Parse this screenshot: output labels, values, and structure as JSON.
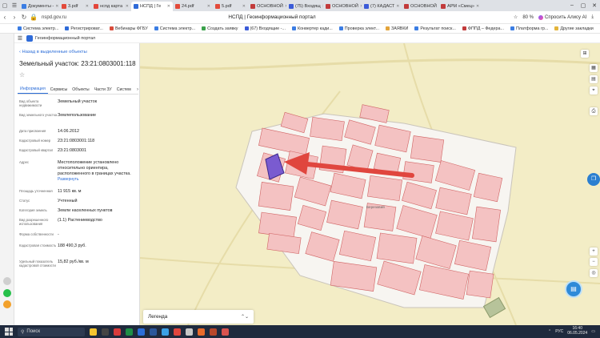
{
  "browser": {
    "tabs": [
      {
        "label": "Документы -",
        "color": "#3b7de3"
      },
      {
        "label": "3.pdf",
        "color": "#e34b3b"
      },
      {
        "label": "нспд картa",
        "color": "#e3463b"
      },
      {
        "label": "НСПД | Ге",
        "color": "#2f6bd8",
        "active": true
      },
      {
        "label": "24.pdf",
        "color": "#e34b3b"
      },
      {
        "label": "5.pdf",
        "color": "#e34b3b"
      },
      {
        "label": "ОСНОВНОЙ",
        "color": "#c23b3b"
      },
      {
        "label": "(75) Входящ",
        "color": "#3b5bd8"
      },
      {
        "label": "ОСНОВНОЙ",
        "color": "#c23b3b"
      },
      {
        "label": "(7) КАДАСТ",
        "color": "#3b5bd8"
      },
      {
        "label": "ОСНОВНОЙ",
        "color": "#c23b3b"
      },
      {
        "label": "АРМ «Смец»",
        "color": "#c23b3b"
      }
    ],
    "url": "nspd.gov.ru",
    "page_title": "НСПД | Геоинформационный портал",
    "battery": "80 %",
    "alisa_label": "Спросить Алису AI",
    "bookmarks": [
      {
        "label": "Система электр...",
        "color": "#3b7de3"
      },
      {
        "label": "Регистрироват...",
        "color": "#2f6bd8"
      },
      {
        "label": "Вебинары ФГБУ",
        "color": "#d84c3b"
      },
      {
        "label": "Система электр...",
        "color": "#3b7de3"
      },
      {
        "label": "Создать заявку",
        "color": "#3ba14b"
      },
      {
        "label": "(67) Входящие -...",
        "color": "#3b5bd8"
      },
      {
        "label": "Конвертер кади...",
        "color": "#3b7de3"
      },
      {
        "label": "Проверка элект...",
        "color": "#3b7de3"
      },
      {
        "label": "ЗАЯВКИ",
        "color": "#e3a43b"
      },
      {
        "label": "Результат поиск...",
        "color": "#3b7de3"
      },
      {
        "label": "ФППД – Федера...",
        "color": "#c23b3b"
      },
      {
        "label": "Платформа гр...",
        "color": "#3b7de3"
      }
    ],
    "other_bookmarks": "Другие закладки"
  },
  "app": {
    "portal_name": "Геоинформационный портал"
  },
  "panel": {
    "back_label": "Назад в выделенные объекты",
    "title": "Земельный участок: 23:21:0803001:118",
    "tabs": [
      "Информация",
      "Сервисы",
      "Объекты",
      "Части ЗУ",
      "Систем"
    ],
    "rows": [
      {
        "label": "Вид объекта недвижимости",
        "value": "Земельный участок"
      },
      {
        "label": "Вид земельного участка",
        "value": "Землепользование"
      },
      {
        "label": "Дата присвоения",
        "value": "14.06.2012"
      },
      {
        "label": "Кадастровый номер",
        "value": "23:21:0803001:118"
      },
      {
        "label": "Кадастровый квартал",
        "value": "23:21:0803001"
      },
      {
        "label": "Адрес",
        "value": "Местоположение установлено относительно ориентира, расположенного в границах участка.",
        "more": "Развернуть"
      },
      {
        "label": "Площадь уточненная",
        "value": "11 915 кв. м"
      },
      {
        "label": "Статус",
        "value": "Учтенный"
      },
      {
        "label": "Категория земель",
        "value": "Земли населенных пунктов"
      },
      {
        "label": "Вид разрешенного использования",
        "value": "(1.1) Растениеводство"
      },
      {
        "label": "Форма собственности",
        "value": "-"
      },
      {
        "label": "Кадастровая стоимость",
        "value": "188 490,3 руб."
      },
      {
        "label": "Удельный показатель кадастровой стоимости",
        "value": "15,82 руб./кв. м"
      }
    ]
  },
  "map": {
    "legend_label": "Легенда",
    "place_label": "Березовий",
    "parcel_fill": "#f4c2c2",
    "parcel_stroke": "#d06464",
    "selected_fill": "#7a5bd0",
    "arrow_color": "#e0463e"
  },
  "taskbar": {
    "search_label": "Поиск",
    "lang": "РУС",
    "time": "16:40",
    "date": "06.05.2024"
  }
}
